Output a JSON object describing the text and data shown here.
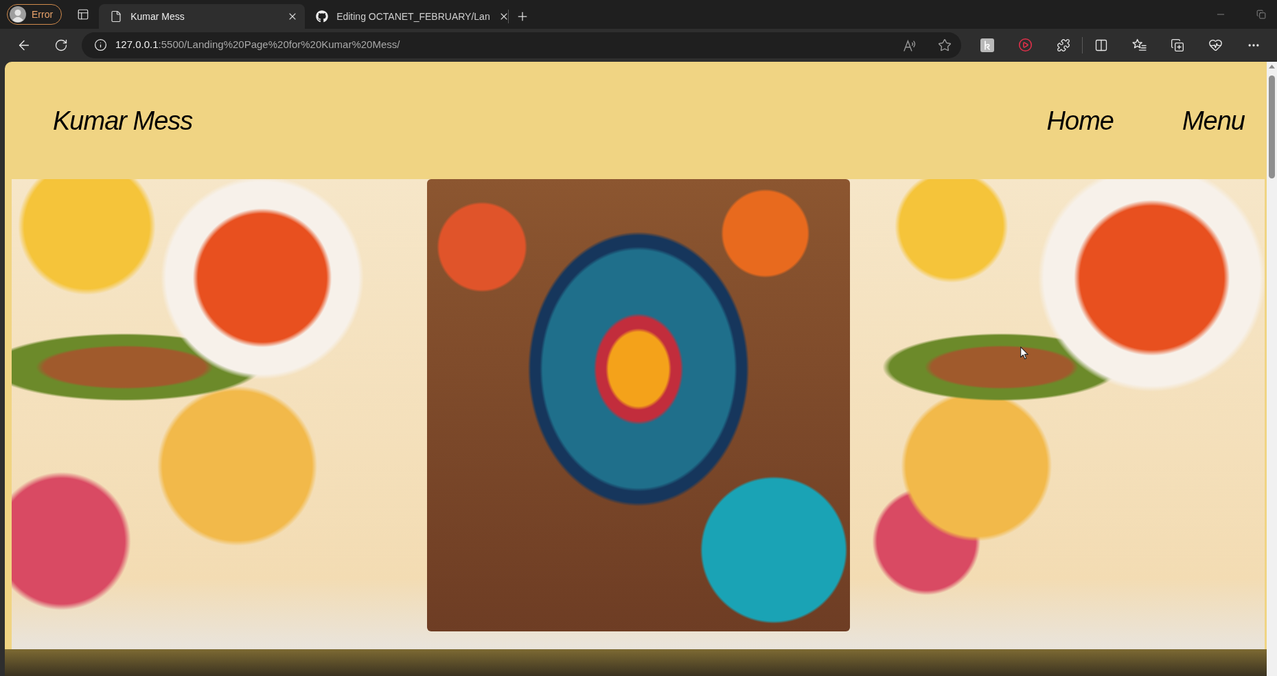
{
  "browser": {
    "profile": {
      "label": "Error"
    },
    "tabs": [
      {
        "title": "Kumar Mess",
        "kind": "page",
        "selected": true
      },
      {
        "title": "Editing OCTANET_FEBRUARY/Lan",
        "kind": "github",
        "selected": false
      }
    ],
    "address": {
      "host": "127.0.0.1",
      "path": ":5500/Landing%20Page%20for%20Kumar%20Mess/"
    }
  },
  "site": {
    "brand": "Kumar Mess",
    "nav": [
      {
        "label": "Home"
      },
      {
        "label": "Menu"
      }
    ]
  }
}
